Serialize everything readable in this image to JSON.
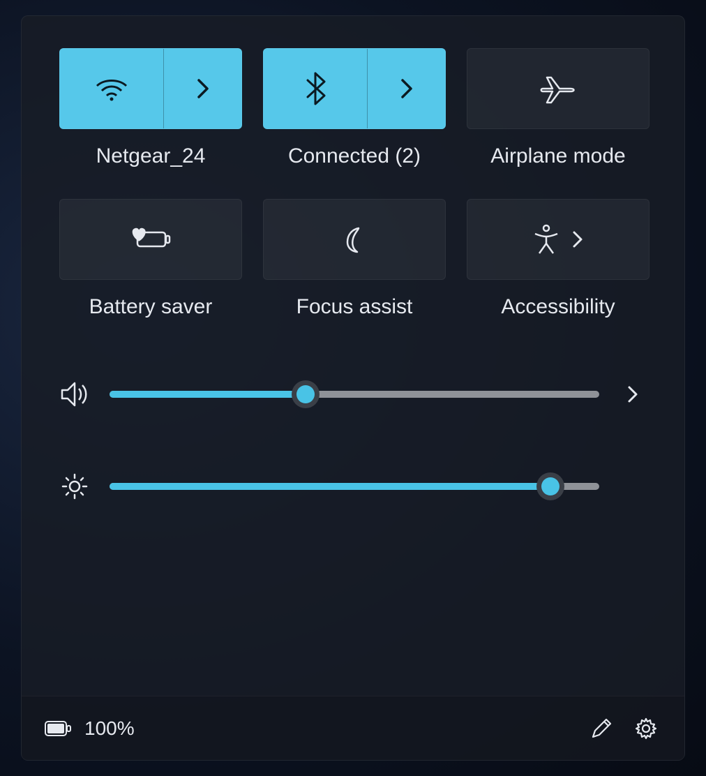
{
  "colors": {
    "accent": "#56c8ea",
    "slider_fill": "#49c3e6",
    "text": "#e6e9ef"
  },
  "tiles": [
    {
      "id": "wifi",
      "label": "Netgear_24",
      "active": true,
      "has_side": true,
      "icon": "wifi-icon"
    },
    {
      "id": "bluetooth",
      "label": "Connected (2)",
      "active": true,
      "has_side": true,
      "icon": "bluetooth-icon"
    },
    {
      "id": "airplane",
      "label": "Airplane mode",
      "active": false,
      "has_side": false,
      "icon": "airplane-icon"
    },
    {
      "id": "battery_saver",
      "label": "Battery saver",
      "active": false,
      "has_side": false,
      "icon": "battery-saver-icon"
    },
    {
      "id": "focus_assist",
      "label": "Focus assist",
      "active": false,
      "has_side": false,
      "icon": "moon-icon"
    },
    {
      "id": "accessibility",
      "label": "Accessibility",
      "active": false,
      "has_side": true,
      "icon": "accessibility-icon"
    }
  ],
  "sliders": {
    "volume": {
      "value": 40,
      "has_more": true
    },
    "brightness": {
      "value": 90,
      "has_more": false
    }
  },
  "footer": {
    "battery_text": "100%"
  }
}
